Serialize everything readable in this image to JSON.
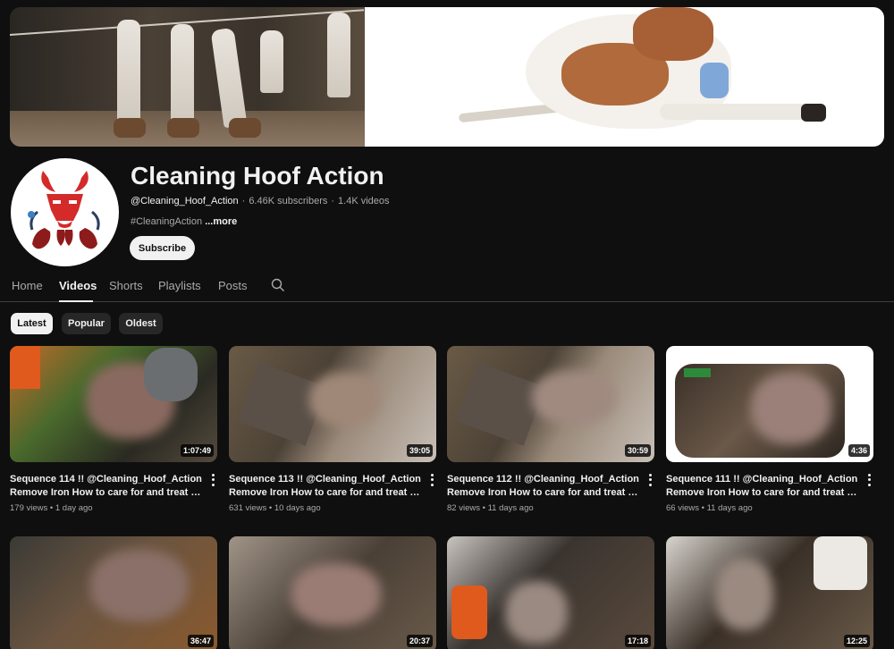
{
  "channel": {
    "name": "Cleaning Hoof Action",
    "handle": "@Cleaning_Hoof_Action",
    "subscribers": "6.46K subscribers",
    "separator": "·",
    "videos_count": "1.4K videos",
    "description": "#CleaningAction",
    "more_label": "...more",
    "subscribe_label": "Subscribe"
  },
  "tabs": [
    {
      "label": "Home"
    },
    {
      "label": "Videos"
    },
    {
      "label": "Shorts"
    },
    {
      "label": "Playlists"
    },
    {
      "label": "Posts"
    }
  ],
  "active_tab": "Videos",
  "filters": [
    {
      "label": "Latest"
    },
    {
      "label": "Popular"
    },
    {
      "label": "Oldest"
    }
  ],
  "active_filter": "Latest",
  "videos": [
    {
      "title1": "Sequence 114 !! @Cleaning_Hoof_Action",
      "title2": "Remove Iron How to care for and treat cattl...",
      "views": "179 views",
      "age": "1 day ago",
      "duration": "1:07:49"
    },
    {
      "title1": "Sequence 113 !! @Cleaning_Hoof_Action",
      "title2": "Remove Iron How to care for and treat cattl...",
      "views": "631 views",
      "age": "10 days ago",
      "duration": "39:05"
    },
    {
      "title1": "Sequence 112 !! @Cleaning_Hoof_Action",
      "title2": "Remove Iron How to care for and treat cattl...",
      "views": "82 views",
      "age": "11 days ago",
      "duration": "30:59"
    },
    {
      "title1": "Sequence 111 !! @Cleaning_Hoof_Action",
      "title2": "Remove Iron How to care for and treat cattl...",
      "views": "66 views",
      "age": "11 days ago",
      "duration": "4:36"
    },
    {
      "duration": "36:47"
    },
    {
      "duration": "20:37"
    },
    {
      "duration": "17:18"
    },
    {
      "duration": "12:25"
    }
  ],
  "meta_separator": "•",
  "colors": {
    "background": "#0f0f0f",
    "text": "#f1f1f1",
    "muted": "#aaaaaa",
    "chip": "#272727",
    "logo_red": "#d42a2a"
  },
  "icons": [
    "channel-logo-bull",
    "search-icon",
    "more-vert-icon"
  ]
}
